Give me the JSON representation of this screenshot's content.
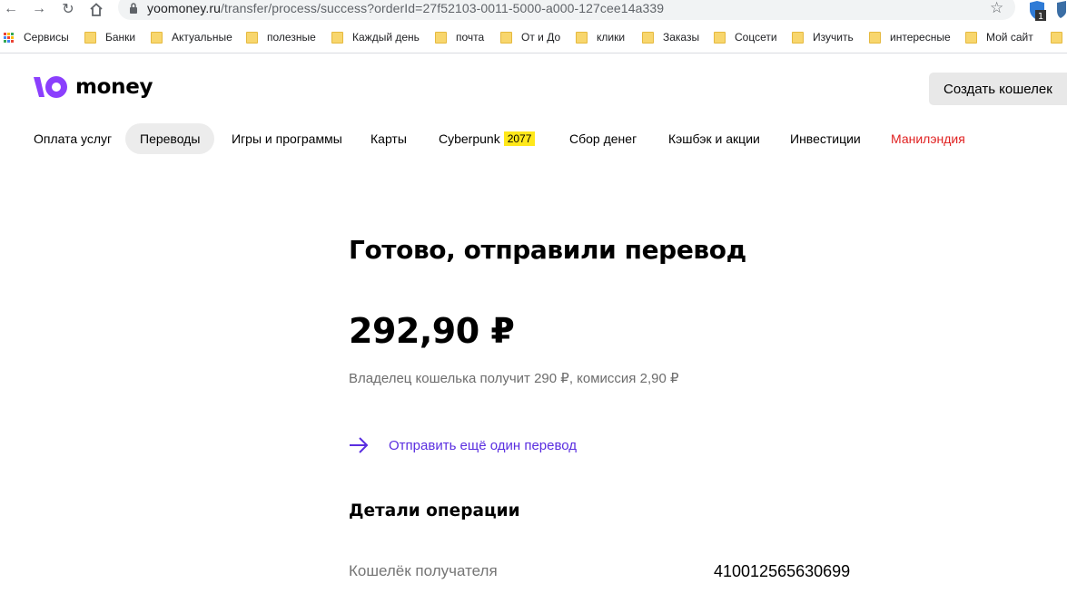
{
  "browser": {
    "url_host": "yoomoney.ru",
    "url_path": "/transfer/process/success?orderId=27f52103-0011-5000-a000-127cee14a339",
    "ext_badge": "1",
    "bookmarks": [
      "Сервисы",
      "Банки",
      "Актуальные",
      "полезные",
      "Каждый день",
      "почта",
      "От и До",
      "клики",
      "Заказы",
      "Соцсети",
      "Изучить",
      "интересные",
      "Мой сайт"
    ]
  },
  "header": {
    "logo_text": "money",
    "create_wallet": "Создать кошелек"
  },
  "menu": {
    "items": [
      "Оплата услуг",
      "Переводы",
      "Игры и программы",
      "Карты",
      "Cyberpunk",
      "Сбор денег",
      "Кэшбэк и акции",
      "Инвестиции",
      "Манилэндия"
    ],
    "cyberpunk_badge": "2077",
    "active_item": "Переводы"
  },
  "main": {
    "title": "Готово, отправили перевод",
    "amount": "292,90 ₽",
    "subinfo": "Владелец кошелька получит 290 ₽, комиссия 2,90 ₽",
    "send_again": "Отправить ещё один перевод",
    "details_heading": "Детали операции",
    "details": [
      {
        "label": "Кошелёк получателя",
        "value": "410012565630699"
      }
    ]
  },
  "colors": {
    "brand_purple": "#8b3ffd",
    "link_purple": "#5a2ee0",
    "highlight_red": "#e01f1f",
    "badge_yellow": "#ffe81a"
  }
}
